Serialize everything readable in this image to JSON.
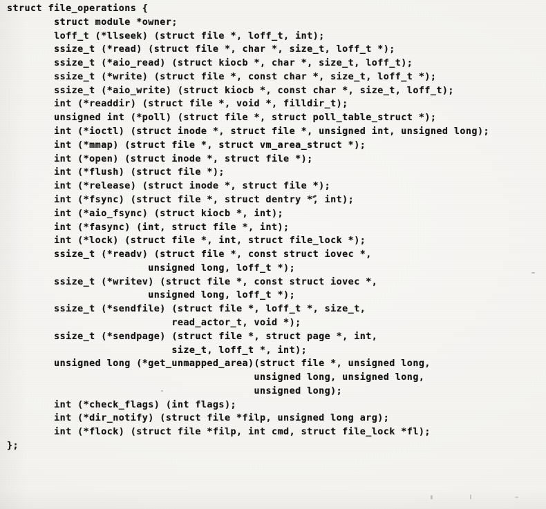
{
  "document": {
    "kind": "scanned-code-listing",
    "language": "C",
    "struct_name": "file_operations",
    "background_color": "#f5f4f1",
    "ink_color": "#131313"
  },
  "code": {
    "lines": [
      "struct file_operations {",
      "        struct module *owner;",
      "        loff_t (*llseek) (struct file *, loff_t, int);",
      "        ssize_t (*read) (struct file *, char *, size_t, loff_t *);",
      "        ssize_t (*aio_read) (struct kiocb *, char *, size_t, loff_t);",
      "        ssize_t (*write) (struct file *, const char *, size_t, loff_t *);",
      "        ssize_t (*aio_write) (struct kiocb *, const char *, size_t, loff_t);",
      "        int (*readdir) (struct file *, void *, filldir_t);",
      "        unsigned int (*poll) (struct file *, struct poll_table_struct *);",
      "        int (*ioctl) (struct inode *, struct file *, unsigned int, unsigned long);",
      "        int (*mmap) (struct file *, struct vm_area_struct *);",
      "        int (*open) (struct inode *, struct file *);",
      "        int (*flush) (struct file *);",
      "        int (*release) (struct inode *, struct file *);",
      "        int (*fsync) (struct file *, struct dentry *, int);",
      "        int (*aio_fsync) (struct kiocb *, int);",
      "        int (*fasync) (int, struct file *, int);",
      "        int (*lock) (struct file *, int, struct file_lock *);",
      "        ssize_t (*readv) (struct file *, const struct iovec *,",
      "                        unsigned long, loff_t *);",
      "        ssize_t (*writev) (struct file *, const struct iovec *,",
      "                        unsigned long, loff_t *);",
      "        ssize_t (*sendfile) (struct file *, loff_t *, size_t,",
      "                            read_actor_t, void *);",
      "        ssize_t (*sendpage) (struct file *, struct page *, int,",
      "                            size_t, loff_t *, int);",
      "        unsigned long (*get_unmapped_area)(struct file *, unsigned long,",
      "                                          unsigned long, unsigned long,",
      "                                          unsigned long);",
      "        int (*check_flags) (int flags);",
      "        int (*dir_notify) (struct file *filp, unsigned long arg);",
      "        int (*flock) (struct file *filp, int cmd, struct file_lock *fl);",
      "};"
    ],
    "text": "struct file_operations {\n        struct module *owner;\n        loff_t (*llseek) (struct file *, loff_t, int);\n        ssize_t (*read) (struct file *, char *, size_t, loff_t *);\n        ssize_t (*aio_read) (struct kiocb *, char *, size_t, loff_t);\n        ssize_t (*write) (struct file *, const char *, size_t, loff_t *);\n        ssize_t (*aio_write) (struct kiocb *, const char *, size_t, loff_t);\n        int (*readdir) (struct file *, void *, filldir_t);\n        unsigned int (*poll) (struct file *, struct poll_table_struct *);\n        int (*ioctl) (struct inode *, struct file *, unsigned int, unsigned long);\n        int (*mmap) (struct file *, struct vm_area_struct *);\n        int (*open) (struct inode *, struct file *);\n        int (*flush) (struct file *);\n        int (*release) (struct inode *, struct file *);\n        int (*fsync) (struct file *, struct dentry *, int);\n        int (*aio_fsync) (struct kiocb *, int);\n        int (*fasync) (int, struct file *, int);\n        int (*lock) (struct file *, int, struct file_lock *);\n        ssize_t (*readv) (struct file *, const struct iovec *,\n                        unsigned long, loff_t *);\n        ssize_t (*writev) (struct file *, const struct iovec *,\n                        unsigned long, loff_t *);\n        ssize_t (*sendfile) (struct file *, loff_t *, size_t,\n                            read_actor_t, void *);\n        ssize_t (*sendpage) (struct file *, struct page *, int,\n                            size_t, loff_t *, int);\n        unsigned long (*get_unmapped_area)(struct file *, unsigned long,\n                                          unsigned long, unsigned long,\n                                          unsigned long);\n        int (*check_flags) (int flags);\n        int (*dir_notify) (struct file *filp, unsigned long arg);\n        int (*flock) (struct file *filp, int cmd, struct file_lock *fl);\n};"
  },
  "members": [
    {
      "name": "owner",
      "type": "struct module *"
    },
    {
      "name": "llseek",
      "returns": "loff_t",
      "params": "struct file *, loff_t, int"
    },
    {
      "name": "read",
      "returns": "ssize_t",
      "params": "struct file *, char *, size_t, loff_t *"
    },
    {
      "name": "aio_read",
      "returns": "ssize_t",
      "params": "struct kiocb *, char *, size_t, loff_t"
    },
    {
      "name": "write",
      "returns": "ssize_t",
      "params": "struct file *, const char *, size_t, loff_t *"
    },
    {
      "name": "aio_write",
      "returns": "ssize_t",
      "params": "struct kiocb *, const char *, size_t, loff_t"
    },
    {
      "name": "readdir",
      "returns": "int",
      "params": "struct file *, void *, filldir_t"
    },
    {
      "name": "poll",
      "returns": "unsigned int",
      "params": "struct file *, struct poll_table_struct *"
    },
    {
      "name": "ioctl",
      "returns": "int",
      "params": "struct inode *, struct file *, unsigned int, unsigned long"
    },
    {
      "name": "mmap",
      "returns": "int",
      "params": "struct file *, struct vm_area_struct *"
    },
    {
      "name": "open",
      "returns": "int",
      "params": "struct inode *, struct file *"
    },
    {
      "name": "flush",
      "returns": "int",
      "params": "struct file *"
    },
    {
      "name": "release",
      "returns": "int",
      "params": "struct inode *, struct file *"
    },
    {
      "name": "fsync",
      "returns": "int",
      "params": "struct file *, struct dentry *, int"
    },
    {
      "name": "aio_fsync",
      "returns": "int",
      "params": "struct kiocb *, int"
    },
    {
      "name": "fasync",
      "returns": "int",
      "params": "int, struct file *, int"
    },
    {
      "name": "lock",
      "returns": "int",
      "params": "struct file *, int, struct file_lock *"
    },
    {
      "name": "readv",
      "returns": "ssize_t",
      "params": "struct file *, const struct iovec *, unsigned long, loff_t *"
    },
    {
      "name": "writev",
      "returns": "ssize_t",
      "params": "struct file *, const struct iovec *, unsigned long, loff_t *"
    },
    {
      "name": "sendfile",
      "returns": "ssize_t",
      "params": "struct file *, loff_t *, size_t, read_actor_t, void *"
    },
    {
      "name": "sendpage",
      "returns": "ssize_t",
      "params": "struct file *, struct page *, int, size_t, loff_t *, int"
    },
    {
      "name": "get_unmapped_area",
      "returns": "unsigned long",
      "params": "struct file *, unsigned long, unsigned long, unsigned long, unsigned long"
    },
    {
      "name": "check_flags",
      "returns": "int",
      "params": "int flags"
    },
    {
      "name": "dir_notify",
      "returns": "int",
      "params": "struct file *filp, unsigned long arg"
    },
    {
      "name": "flock",
      "returns": "int",
      "params": "struct file *filp, int cmd, struct file_lock *fl"
    }
  ]
}
